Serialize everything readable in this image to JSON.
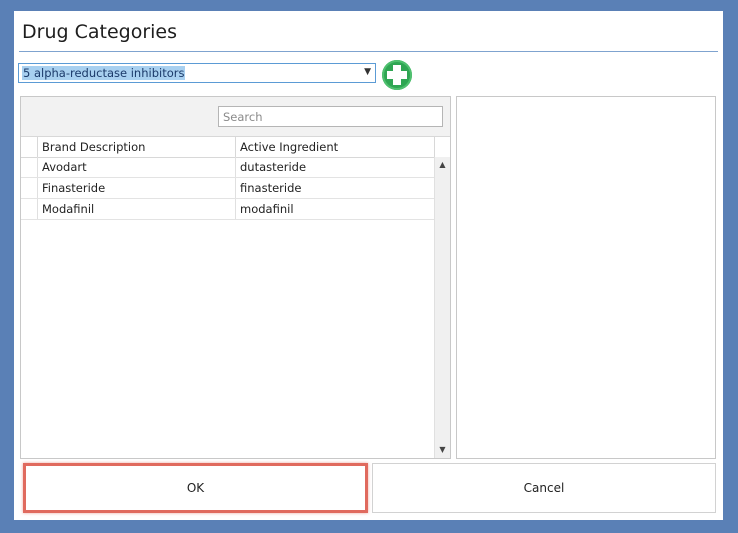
{
  "dialog": {
    "title": "Drug Categories"
  },
  "category_select": {
    "selected": "5 alpha-reductase inhibitors"
  },
  "add_button": {
    "icon": "plus-circle-icon",
    "color": "#2fa653"
  },
  "search": {
    "placeholder": "Search"
  },
  "grid": {
    "columns": [
      "Brand Description",
      "Active Ingredient"
    ],
    "rows": [
      {
        "brand": "Avodart",
        "ingredient": "dutasteride"
      },
      {
        "brand": "Finasteride",
        "ingredient": "finasteride"
      },
      {
        "brand": "Modafinil",
        "ingredient": "modafinil"
      }
    ]
  },
  "buttons": {
    "ok_label": "OK",
    "cancel_label": "Cancel"
  },
  "colors": {
    "window_background": "#5a80b6",
    "highlight": "#e06a5e",
    "selection": "#a8d0f0"
  }
}
